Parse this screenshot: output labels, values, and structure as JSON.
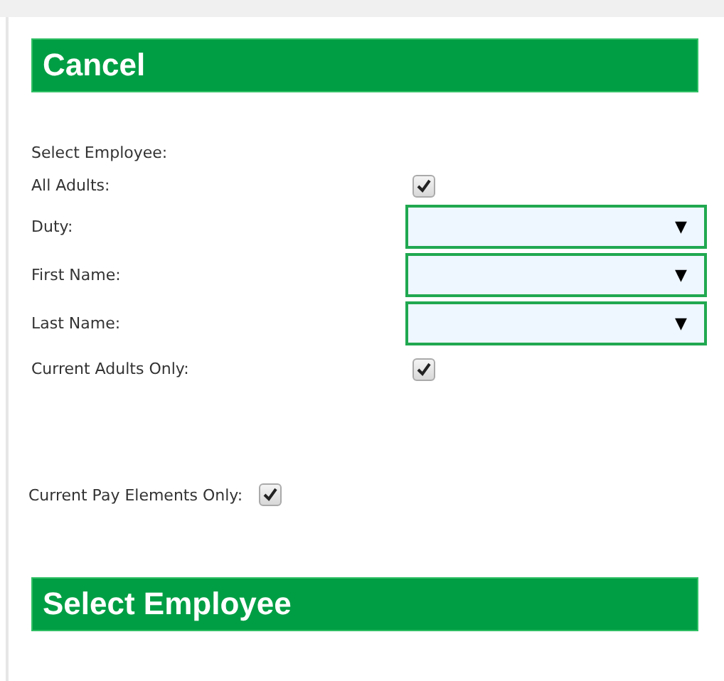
{
  "header": {
    "title": "Cancel"
  },
  "heading": "Select Employee:",
  "fields": [
    {
      "kind": "checkbox",
      "label": "All Adults:",
      "checked": true
    },
    {
      "kind": "select",
      "label": "Duty:",
      "arrow": "▼"
    },
    {
      "kind": "select",
      "label": "First Name:",
      "arrow": "▼"
    },
    {
      "kind": "select",
      "label": "Last Name:",
      "arrow": "▼"
    },
    {
      "kind": "checkbox",
      "label": "Current Adults Only:",
      "checked": true
    }
  ],
  "pay_elements": {
    "label": "Current Pay Elements Only:",
    "checked": true
  },
  "footer": {
    "title": "Select Employee"
  }
}
